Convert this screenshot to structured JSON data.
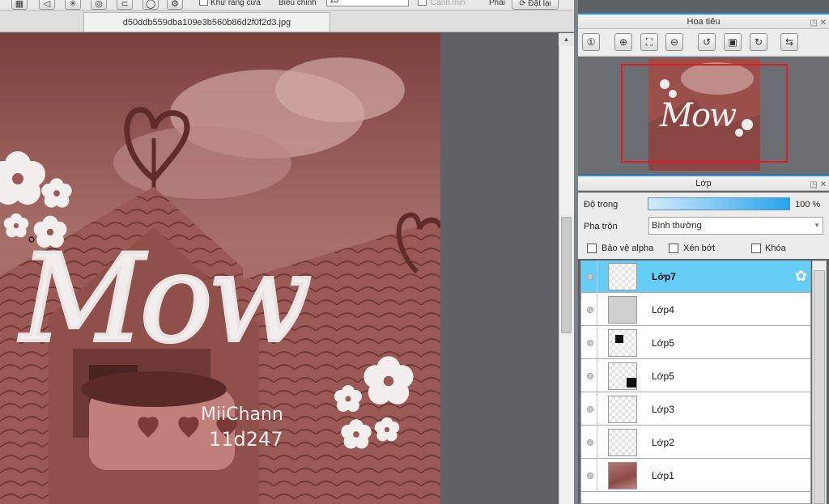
{
  "toolbar": {
    "check1_label": "Khử răng cưa",
    "check2_label": "Biểu chỉnh",
    "value_field": "15",
    "apply_label": "Canh mịn",
    "fit_label": "Phải",
    "reset_label": "Đặt lại"
  },
  "document": {
    "tab_title": "d50ddb559dba109e3b560b86d2f0f2d3.jpg"
  },
  "artwork": {
    "main_text": "Mow",
    "signature_line1": "MiiChann",
    "signature_line2": "11d247"
  },
  "navigator": {
    "title": "Hoa tiêu",
    "thumb_text": "Mow"
  },
  "layers_panel": {
    "title": "Lớp",
    "opacity_label": "Độ trong",
    "opacity_value": "100 %",
    "opacity": 1.0,
    "blend_label": "Pha trộn",
    "blend_value": "Bình thường",
    "protect_alpha": "Bảo vệ alpha",
    "clipping": "Xén bớt",
    "lock": "Khóa",
    "layers": [
      {
        "name": "Lớp7",
        "active": true
      },
      {
        "name": "Lớp4"
      },
      {
        "name": "Lớp5"
      },
      {
        "name": "Lớp5"
      },
      {
        "name": "Lớp3"
      },
      {
        "name": "Lớp2"
      },
      {
        "name": "Lớp1"
      }
    ]
  },
  "colors": {
    "accent": "#2f8fd6",
    "active_layer": "#66cdf7",
    "nav_frame": "#e21b24",
    "canvas_tint": "#8a4c48"
  }
}
